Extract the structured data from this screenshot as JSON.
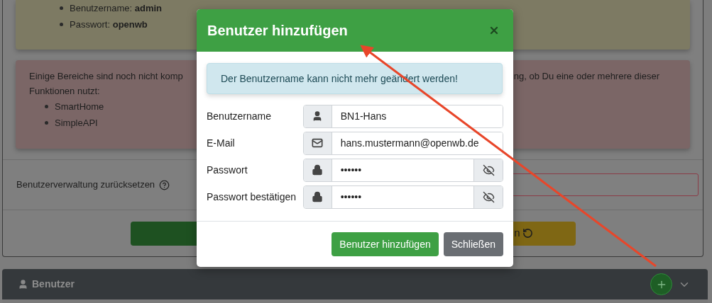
{
  "background": {
    "credentials": [
      "Benutzername: **admin**",
      "Passwort: **openwb**"
    ],
    "notice": {
      "text_left": "Einige Bereiche sind noch nicht komp",
      "text_right": "ng, ob Du eine oder mehrere dieser",
      "line_2": "Funktionen nutzt:",
      "items": [
        "SmartHome",
        "SimpleAPI"
      ]
    },
    "reset": {
      "label": "Benutzerverwaltung zurücksetzen"
    },
    "reset_button": {
      "label": "n"
    },
    "users_panel": {
      "title": "Benutzer"
    }
  },
  "dialog": {
    "title": "Benutzer hinzufügen",
    "info": "Der Benutzername kann nicht mehr geändert werden!",
    "fields": [
      {
        "kind": "user",
        "label": "Benutzername",
        "value": "BN1-Hans"
      },
      {
        "kind": "email",
        "label": "E-Mail",
        "value": "hans.mustermann@openwb.de"
      },
      {
        "kind": "password",
        "label": "Passwort",
        "value": "••••••"
      },
      {
        "kind": "password",
        "label": "Passwort bestätigen",
        "value": "••••••"
      }
    ],
    "buttons": [
      {
        "kind": "primary",
        "label": "Benutzer hinzufügen"
      },
      {
        "kind": "secondary",
        "label": "Schließen"
      }
    ]
  }
}
